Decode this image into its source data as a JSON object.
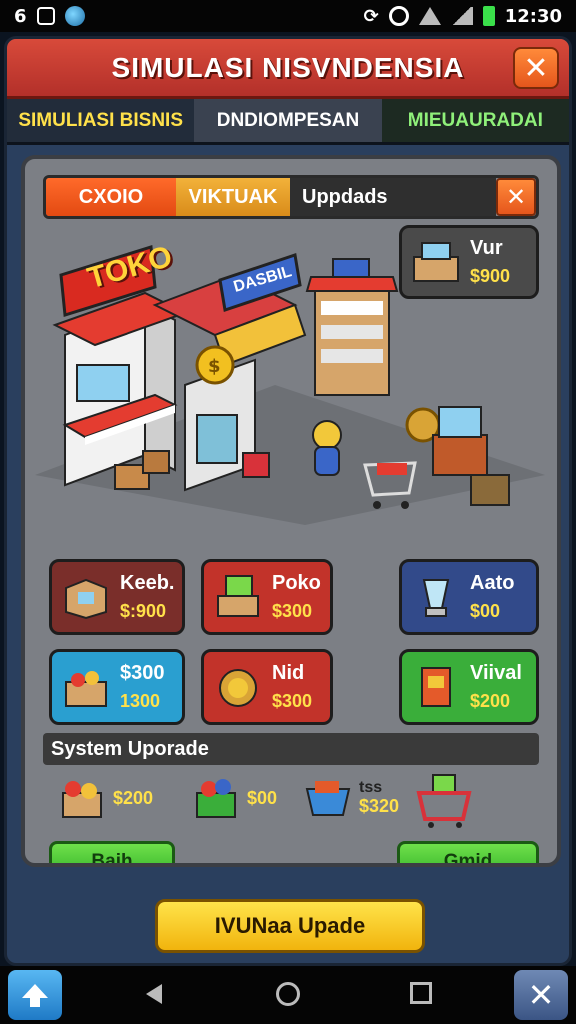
{
  "status_bar": {
    "left_icons": [
      "digit-6",
      "box-icon",
      "globe-icon"
    ],
    "time": "12:30"
  },
  "window": {
    "title": "SIMULASI NISVNDENSIA",
    "close_label": "✕"
  },
  "tabs": [
    {
      "label": "SIMULIASI BISNIS"
    },
    {
      "label": "DNDIOMPESAN"
    },
    {
      "label": "MIEUAURADAI"
    }
  ],
  "subtabs": {
    "items": [
      {
        "label": "CXOIO"
      },
      {
        "label": "VIKTUAK"
      },
      {
        "label": "Uppdads"
      }
    ],
    "close_label": "✕"
  },
  "scene": {
    "store_sign": "TOKO",
    "shop_sign": "DASBIL",
    "vur_card": {
      "name": "Vur",
      "price": "$900"
    }
  },
  "items": [
    {
      "name": "Keeb.",
      "price": "$:900",
      "color": "#7a2e2a"
    },
    {
      "name": "Poko",
      "price": "$300",
      "color": "#c2332a"
    },
    {
      "name": "Aato",
      "price": "$00",
      "color": "#324a8a"
    },
    {
      "name": "$300",
      "price": "1300",
      "color": "#2a9fd0"
    },
    {
      "name": "Nid",
      "price": "$300",
      "color": "#c2332a"
    },
    {
      "name": "Viival",
      "price": "$200",
      "color": "#3aae3a"
    }
  ],
  "system_upgrade": {
    "label": "System Uporade",
    "items": [
      {
        "price": "$200"
      },
      {
        "price": "$00"
      },
      {
        "label": "tss",
        "price": "$320"
      },
      {
        "price": ""
      }
    ],
    "left_button": "Baih",
    "right_button": "Gmid"
  },
  "main_button": "IVUNaa Upade",
  "navbar": {
    "close_label": "✕"
  }
}
